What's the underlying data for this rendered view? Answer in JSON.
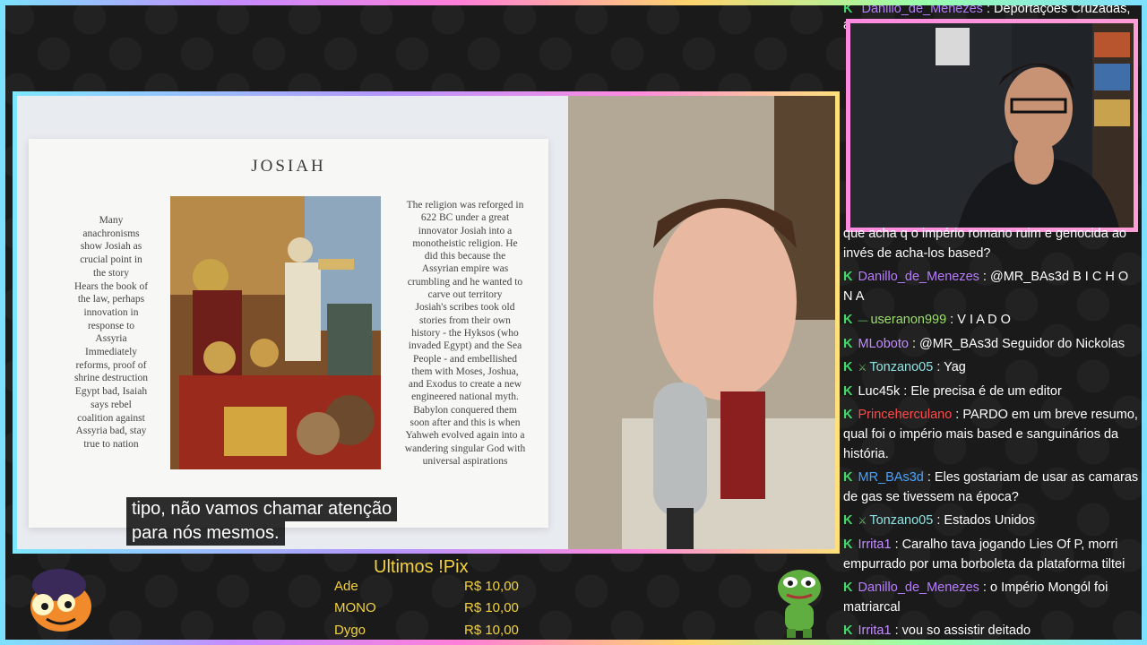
{
  "slide": {
    "title": "JOSIAH",
    "left_text": "Many\nanachronisms\nshow Josiah as\ncrucial point in\nthe story\nHears the book of\nthe law, perhaps\ninnovation in\nresponse to\nAssyria\nImmediately\nreforms, proof of\nshrine destruction\nEgypt bad, Isaiah\nsays rebel\ncoalition against\nAssyria bad, stay\ntrue to nation",
    "right_text": "The religion was reforged in\n622 BC under a great\ninnovator Josiah into a\nmonotheistic religion. He\ndid this because the\nAssyrian empire was\ncrumbling and he wanted to\ncarve out territory\nJosiah's scribes took old\nstories from their own\nhistory - the Hyksos (who\ninvaded Egypt) and the Sea\nPeople - and embellished\nthem with Moses, Joshua,\nand Exodus to create a new\nengineered national myth.\nBabylon conquered them\nsoon after and this is when\nYahweh evolved again into a\nwandering singular God with\nuniversal aspirations"
  },
  "subtitle": {
    "line1": "tipo, não vamos chamar atenção",
    "line2": "para nós mesmos."
  },
  "chat_top": {
    "user": "Danillo_de_Menezes",
    "text": "Deportações Cruzadas,",
    "overflow_char": "a"
  },
  "chat": [
    {
      "user": "",
      "text": "que acha q o império romano ruim e genocida ao invés de acha-los based?",
      "color": "#ffffff",
      "badge": false
    },
    {
      "user": "Danillo_de_Menezes",
      "text": "@MR_BAs3d B I C H O N A",
      "color": "#b77cff",
      "badge": true
    },
    {
      "user": "useranon999",
      "text": "V I A D O",
      "color": "#9ddf6a",
      "badge": true,
      "extra": "—"
    },
    {
      "user": "MLoboto",
      "text": "@MR_BAs3d Seguidor do Nickolas",
      "color": "#c28cff",
      "badge": true
    },
    {
      "user": "Tonzano05",
      "text": "Yag",
      "color": "#8fe3e3",
      "badge": true,
      "extra": "⚔"
    },
    {
      "user": "Luc45k",
      "text": "Ele precisa é de um editor",
      "color": "#ffffff",
      "badge": true
    },
    {
      "user": "Princeherculano",
      "text": "PARDO em um breve resumo, qual foi o império mais based e sanguinários da história.",
      "color": "#ff4a4a",
      "badge": true
    },
    {
      "user": "MR_BAs3d",
      "text": "Eles gostariam de usar as camaras de gas se tivessem na época?",
      "color": "#4aa3ff",
      "badge": true
    },
    {
      "user": "Tonzano05",
      "text": "Estados Unidos",
      "color": "#8fe3e3",
      "badge": true,
      "extra": "⚔"
    },
    {
      "user": "Irrita1",
      "text": "Caralho tava jogando Lies Of P, morri empurrado por uma borboleta da plataforma tiltei",
      "color": "#c28cff",
      "badge": true
    },
    {
      "user": "Danillo_de_Menezes",
      "text": "o Império Mongól foi matriarcal",
      "color": "#b77cff",
      "badge": true
    },
    {
      "user": "Irrita1",
      "text": "vou so assistir deitado",
      "color": "#c28cff",
      "badge": true
    }
  ],
  "pix": {
    "title": "Ultimos !Pix",
    "rows": [
      {
        "name": "Ade",
        "amount": "R$ 10,00"
      },
      {
        "name": "MONO",
        "amount": "R$ 10,00"
      },
      {
        "name": "Dygo",
        "amount": "R$ 10,00"
      }
    ]
  },
  "colors": {
    "accent_pink": "#ff8ae0",
    "pix_yellow": "#f3d23e",
    "badge_green": "#45d86a"
  }
}
